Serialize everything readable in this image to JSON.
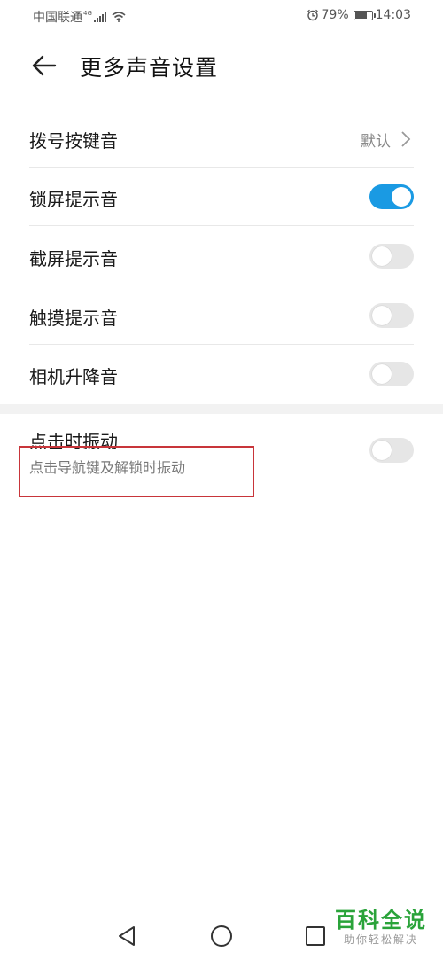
{
  "status_bar": {
    "carrier": "中国联通",
    "network": "4G",
    "battery": "79%",
    "battery_level": 0.79,
    "time": "14:03"
  },
  "header": {
    "back_icon": "arrow-left-icon",
    "title": "更多声音设置"
  },
  "settings": {
    "dial_tone": {
      "label": "拨号按键音",
      "value": "默认"
    },
    "lock_sound": {
      "label": "锁屏提示音",
      "enabled": true
    },
    "screenshot_sound": {
      "label": "截屏提示音",
      "enabled": false
    },
    "touch_sound": {
      "label": "触摸提示音",
      "enabled": false
    },
    "camera_lift_sound": {
      "label": "相机升降音",
      "enabled": false
    },
    "vibrate_on_tap": {
      "label": "点击时振动",
      "description": "点击导航键及解锁时振动",
      "enabled": false
    }
  },
  "colors": {
    "toggle_on": "#1a9ae3",
    "toggle_off": "#e6e6e6",
    "highlight": "#c8353a",
    "watermark": "#2aa33a"
  },
  "navbar": {
    "back": "triangle-back-icon",
    "home": "circle-home-icon",
    "recents": "square-recents-icon"
  },
  "watermark": {
    "title": "百科全说",
    "subtitle": "助你轻松解决"
  }
}
